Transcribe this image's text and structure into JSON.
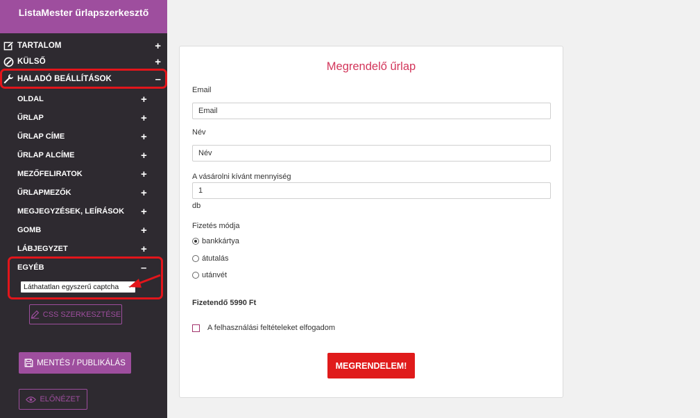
{
  "app": {
    "title": "ListaMester űrlapszerkesztő"
  },
  "sidebar": {
    "sections": [
      {
        "label": "TARTALOM",
        "icon": "edit-icon",
        "toggle": "+"
      },
      {
        "label": "KÜLSŐ",
        "icon": "palette-icon",
        "toggle": "+"
      },
      {
        "label": "HALADÓ BEÁLLÍTÁSOK",
        "icon": "wrench-icon",
        "toggle": "–"
      }
    ],
    "subitems": [
      {
        "label": "OLDAL",
        "toggle": "+"
      },
      {
        "label": "ŰRLAP",
        "toggle": "+"
      },
      {
        "label": "ŰRLAP CÍME",
        "toggle": "+"
      },
      {
        "label": "ŰRLAP ALCÍME",
        "toggle": "+"
      },
      {
        "label": "MEZŐFELIRATOK",
        "toggle": "+"
      },
      {
        "label": "ŰRLAPMEZŐK",
        "toggle": "+"
      },
      {
        "label": "MEGJEGYZÉSEK, LEÍRÁSOK",
        "toggle": "+"
      },
      {
        "label": "GOMB",
        "toggle": "+"
      },
      {
        "label": "LÁBJEGYZET",
        "toggle": "+"
      },
      {
        "label": "EGYÉB",
        "toggle": "–"
      }
    ],
    "captcha_select": {
      "value": "Láthatatlan egyszerű captcha"
    },
    "css_button": "CSS SZERKESZTÉSE",
    "save_button": "MENTÉS / PUBLIKÁLÁS",
    "preview_button": "ELŐNÉZET",
    "accent_color": "#9e4e9e",
    "highlight_color": "#e2151b"
  },
  "form": {
    "title": "Megrendelő űrlap",
    "email": {
      "label": "Email",
      "placeholder": "Email"
    },
    "name": {
      "label": "Név",
      "placeholder": "Név"
    },
    "quantity": {
      "label": "A vásárolni kívánt mennyiség",
      "value": "1",
      "unit": "db"
    },
    "payment": {
      "label": "Fizetés módja",
      "options": [
        {
          "label": "bankkártya",
          "selected": true
        },
        {
          "label": "átutalás",
          "selected": false
        },
        {
          "label": "utánvét",
          "selected": false
        }
      ]
    },
    "total": "Fizetendő 5990 Ft",
    "terms": "A felhasználási feltételeket elfogadom",
    "submit": "MEGRENDELEM!",
    "title_color": "#d2355a",
    "submit_color": "#e01b1b"
  }
}
